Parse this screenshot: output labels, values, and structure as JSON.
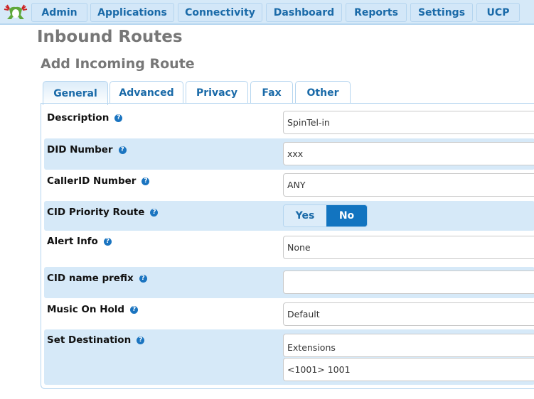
{
  "nav": {
    "logo": "frog-logo",
    "items": [
      {
        "label": "Admin"
      },
      {
        "label": "Applications"
      },
      {
        "label": "Connectivity"
      },
      {
        "label": "Dashboard"
      },
      {
        "label": "Reports"
      },
      {
        "label": "Settings"
      },
      {
        "label": "UCP"
      }
    ]
  },
  "header": {
    "title": "Inbound Routes",
    "subtitle": "Add Incoming Route"
  },
  "tabs": [
    {
      "label": "General",
      "active": true
    },
    {
      "label": "Advanced",
      "active": false
    },
    {
      "label": "Privacy",
      "active": false
    },
    {
      "label": "Fax",
      "active": false
    },
    {
      "label": "Other",
      "active": false
    }
  ],
  "form": {
    "help_glyph": "?",
    "description": {
      "label": "Description",
      "value": "SpinTel-in"
    },
    "did_number": {
      "label": "DID Number",
      "value": "xxx"
    },
    "callerid_number": {
      "label": "CallerID Number",
      "value": "ANY"
    },
    "cid_priority_route": {
      "label": "CID Priority Route",
      "options": [
        "Yes",
        "No"
      ],
      "selected": "No"
    },
    "alert_info": {
      "label": "Alert Info",
      "value": "None"
    },
    "cid_name_prefix": {
      "label": "CID name prefix",
      "value": ""
    },
    "music_on_hold": {
      "label": "Music On Hold",
      "value": "Default"
    },
    "set_destination": {
      "label": "Set Destination",
      "category": "Extensions",
      "target": "<1001> 1001"
    }
  },
  "colors": {
    "accent": "#1274c0",
    "nav_bg": "#d6e9f8",
    "link_text": "#1a6aa8",
    "title_gray": "#777777"
  }
}
